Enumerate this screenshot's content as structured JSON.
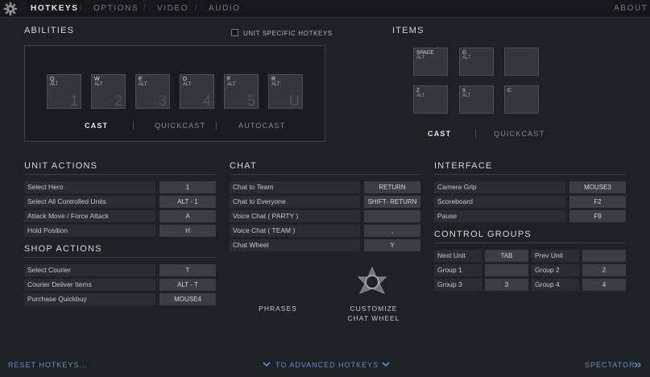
{
  "tabs": [
    "HOTKEYS",
    "OPTIONS",
    "VIDEO",
    "AUDIO"
  ],
  "tab_separator": "/",
  "about_label": "ABOUT",
  "abilities": {
    "title": "ABILITIES",
    "unit_specific_label": "UNIT SPECIFIC HOTKEYS",
    "keys": [
      {
        "key": "Q",
        "alt": "ALT",
        "num": "1"
      },
      {
        "key": "W",
        "alt": "ALT",
        "num": "2"
      },
      {
        "key": "E",
        "alt": "ALT",
        "num": "3"
      },
      {
        "key": "D",
        "alt": "ALT",
        "num": "4"
      },
      {
        "key": "F",
        "alt": "ALT",
        "num": "5"
      },
      {
        "key": "R",
        "alt": "ALT",
        "num": "U"
      }
    ],
    "modes": [
      "CAST",
      "QUICKCAST",
      "AUTOCAST"
    ]
  },
  "items": {
    "title": "ITEMS",
    "slots": [
      {
        "key": "SPACE",
        "alt": "ALT"
      },
      {
        "key": "G",
        "alt": "ALT"
      },
      {
        "key": "",
        "alt": ""
      },
      {
        "key": "Z",
        "alt": "ALT"
      },
      {
        "key": "X",
        "alt": "ALT"
      },
      {
        "key": "C",
        "alt": ""
      }
    ],
    "modes": [
      "CAST",
      "QUICKCAST"
    ]
  },
  "unit_actions": {
    "title": "UNIT ACTIONS",
    "rows": [
      {
        "label": "Select Hero",
        "key": "1"
      },
      {
        "label": "Select All Controlled Units",
        "key": "ALT - 1"
      },
      {
        "label": "Attack Move / Force Attack",
        "key": "A"
      },
      {
        "label": "Hold Position",
        "key": "H"
      }
    ]
  },
  "shop_actions": {
    "title": "SHOP ACTIONS",
    "rows": [
      {
        "label": "Select Courier",
        "key": "T"
      },
      {
        "label": "Courier Deliver Items",
        "key": "ALT - T"
      },
      {
        "label": "Purchase Quickbuy",
        "key": "MOUSE4"
      }
    ]
  },
  "chat": {
    "title": "CHAT",
    "rows": [
      {
        "label": "Chat to Team",
        "key": "RETURN"
      },
      {
        "label": "Chat to Everyone",
        "key": "SHIFT- RETURN"
      },
      {
        "label": "Voice Chat ( PARTY )",
        "key": ""
      },
      {
        "label": "Voice Chat ( TEAM )",
        "key": ","
      },
      {
        "label": "Chat Wheel",
        "key": "Y"
      }
    ],
    "phrases_label": "PHRASES",
    "customize_label_1": "CUSTOMIZE",
    "customize_label_2": "CHAT WHEEL"
  },
  "interface": {
    "title": "INTERFACE",
    "rows": [
      {
        "label": "Camera Grip",
        "key": "MOUSE3"
      },
      {
        "label": "Scoreboard",
        "key": "F2"
      },
      {
        "label": "Pause",
        "key": "F9"
      }
    ]
  },
  "control_groups": {
    "title": "CONTROL GROUPS",
    "rows": [
      {
        "l1": "Next Unit",
        "k1": "TAB",
        "l2": "Prev Unit",
        "k2": ""
      },
      {
        "l1": "Group 1",
        "k1": "",
        "l2": "Group 2",
        "k2": "2"
      },
      {
        "l1": "Group 3",
        "k1": "3",
        "l2": "Group 4",
        "k2": "4"
      }
    ]
  },
  "footer": {
    "reset": "RESET HOTKEYS...",
    "advanced": "TO ADVANCED HOTKEYS",
    "spectator": "SPECTATOR"
  },
  "icons": {
    "settings": "gear-icon",
    "chat_wheel": "chat-wheel-icon",
    "advanced_left": "chevron-down-icon",
    "advanced_right": "chevron-down-icon",
    "spectator": "double-chevron-right-icon"
  },
  "colors": {
    "background": "#1f2225",
    "accent_link": "#5d93c7",
    "tile": "#33383d",
    "key_field": "#3a3f44"
  }
}
